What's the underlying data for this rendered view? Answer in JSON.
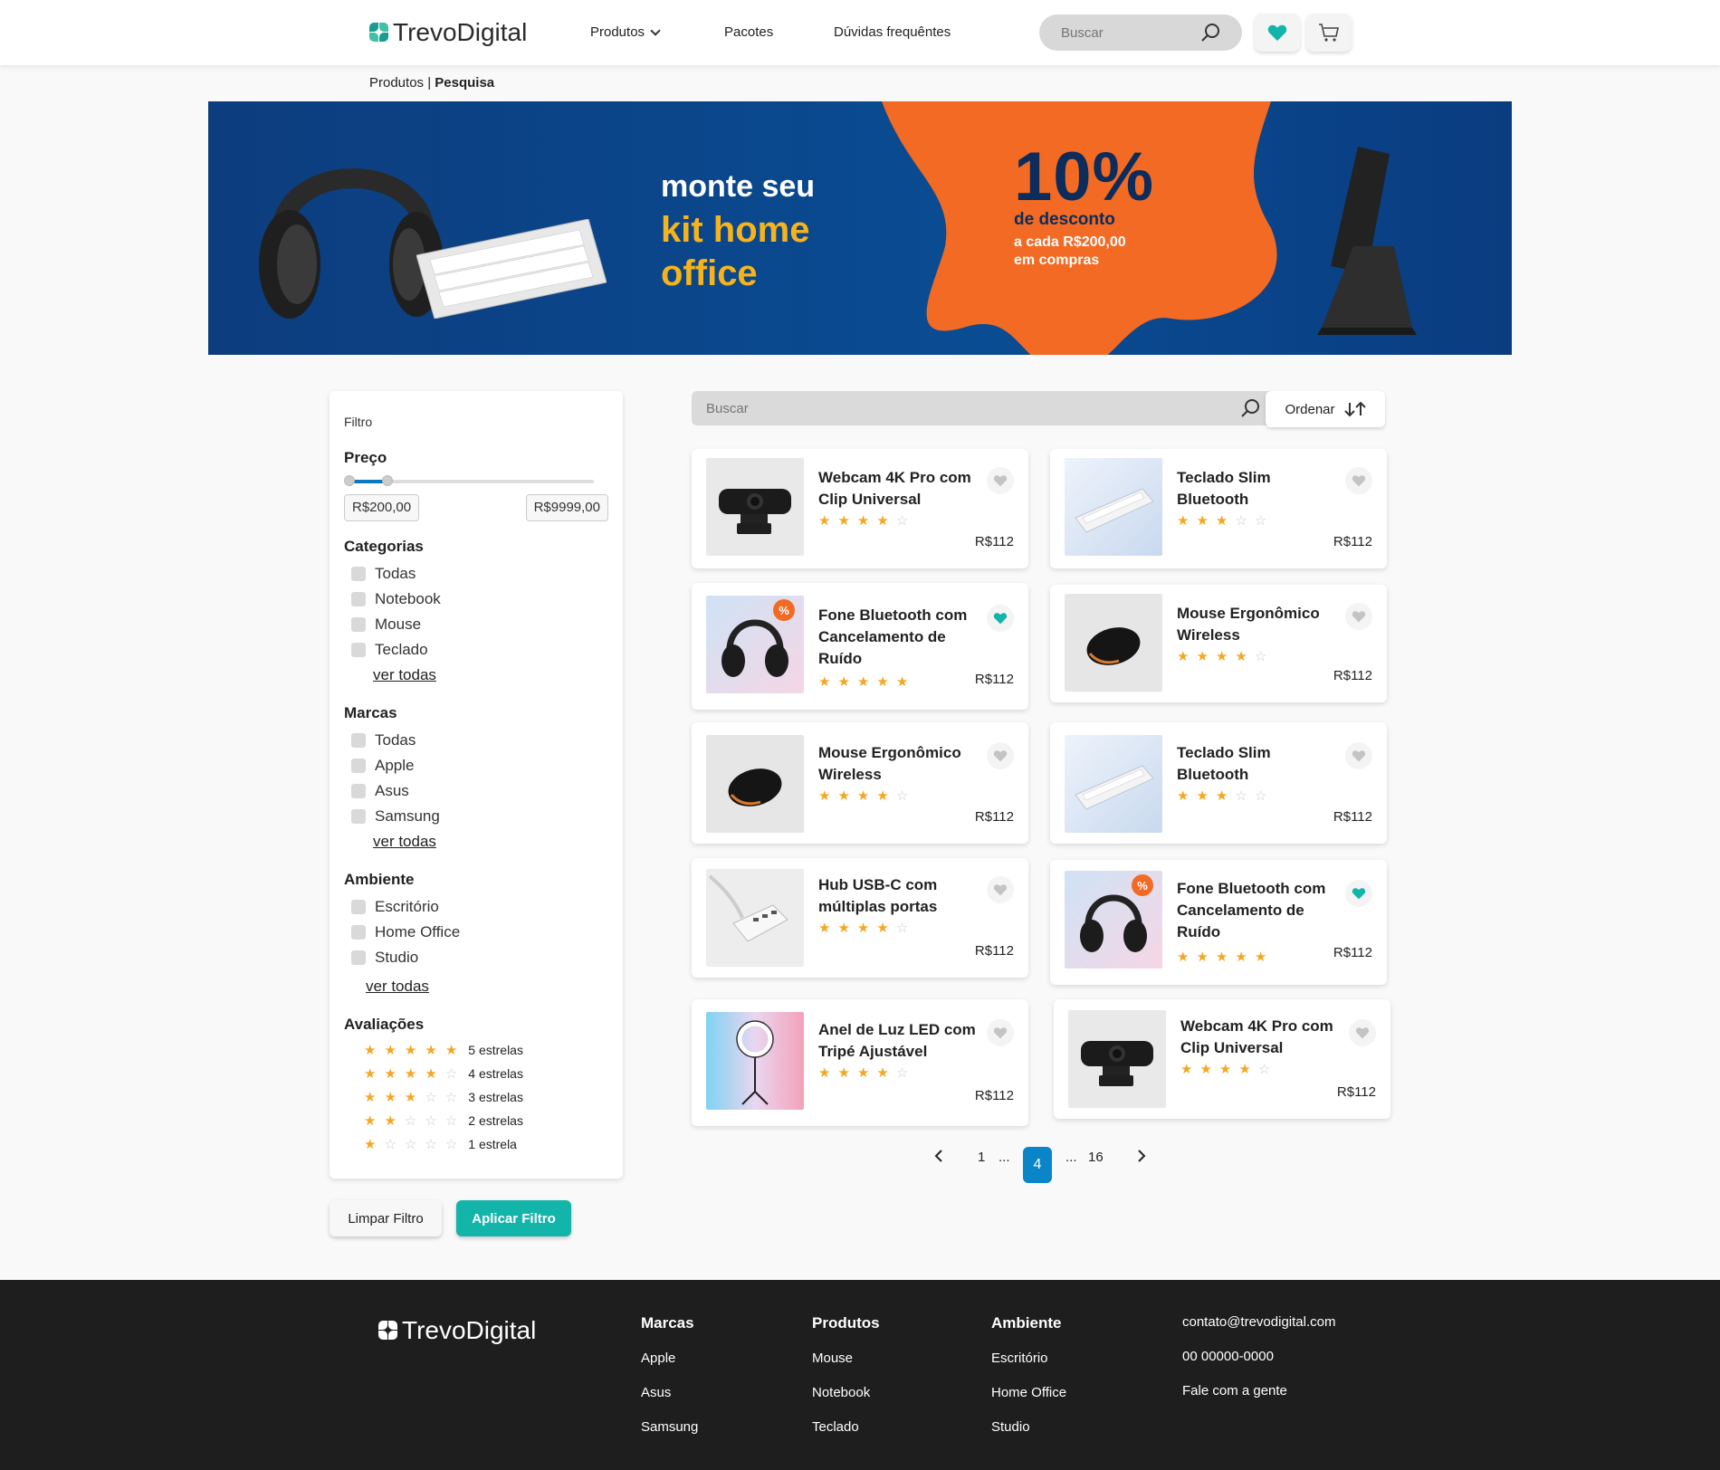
{
  "header": {
    "brand": "TrevoDigital",
    "nav": [
      "Produtos",
      "Pacotes",
      "Dúvidas frequêntes"
    ],
    "search_placeholder": "Buscar"
  },
  "breadcrumb": {
    "parent": "Produtos",
    "separator": " | ",
    "current": "Pesquisa"
  },
  "banner": {
    "line1": "monte seu",
    "line2": "kit home",
    "line3": "office",
    "percent": "10%",
    "discount": "de desconto",
    "condition_1": "a cada R$200,00",
    "condition_2": "em compras",
    "colors": {
      "background": "#0a4c93",
      "blob": "#f26a23",
      "highlight": "#f6b31b"
    }
  },
  "filter": {
    "title": "Filtro",
    "price": {
      "heading": "Preço",
      "min": "R$200,00",
      "max": "R$9999,00"
    },
    "categories": {
      "heading": "Categorias",
      "items": [
        "Todas",
        "Notebook",
        "Mouse",
        "Teclado"
      ],
      "more": "ver todas"
    },
    "brands": {
      "heading": "Marcas",
      "items": [
        "Todas",
        "Apple",
        "Asus",
        "Samsung"
      ],
      "more": "ver todas"
    },
    "environment": {
      "heading": "Ambiente",
      "items": [
        "Escritório",
        "Home Office",
        "Studio"
      ],
      "more": "ver todas"
    },
    "ratings": {
      "heading": "Avaliações",
      "items": [
        "5 estrelas",
        "4 estrelas",
        "3 estrelas",
        "2 estrelas",
        "1 estrela"
      ],
      "values": [
        5,
        4,
        3,
        2,
        1
      ]
    },
    "clear_label": "Limpar Filtro",
    "apply_label": "Aplicar Filtro"
  },
  "list": {
    "search_placeholder": "Buscar",
    "order_label": "Ordenar",
    "products": [
      {
        "name": "Webcam 4K Pro com Clip Universal",
        "rating": 4,
        "price": "R$112",
        "favorite": false,
        "image": "webcam"
      },
      {
        "name": "Teclado Slim Bluetooth",
        "rating": 3,
        "price": "R$112",
        "favorite": false,
        "image": "keyboard"
      },
      {
        "name": "Fone Bluetooth com Cancelamento de Ruído",
        "rating": 5,
        "price": "R$112",
        "favorite": true,
        "image": "headphones"
      },
      {
        "name": "Mouse Ergonômico Wireless",
        "rating": 4,
        "price": "R$112",
        "favorite": false,
        "image": "mouse"
      },
      {
        "name": "Mouse Ergonômico Wireless",
        "rating": 4,
        "price": "R$112",
        "favorite": false,
        "image": "mouse"
      },
      {
        "name": "Teclado Slim Bluetooth",
        "rating": 3,
        "price": "R$112",
        "favorite": false,
        "image": "keyboard"
      },
      {
        "name": "Hub USB-C com múltiplas portas",
        "rating": 4,
        "price": "R$112",
        "favorite": false,
        "image": "hub"
      },
      {
        "name": "Fone Bluetooth com Cancelamento de Ruído",
        "rating": 5,
        "price": "R$112",
        "favorite": true,
        "image": "headphones"
      },
      {
        "name": "Anel de Luz LED com Tripé Ajustável",
        "rating": 4,
        "price": "R$112",
        "favorite": false,
        "image": "ringlight"
      },
      {
        "name": "Webcam 4K Pro com Clip Universal",
        "rating": 4,
        "price": "R$112",
        "favorite": false,
        "image": "webcam"
      }
    ]
  },
  "pagination": {
    "first": "1",
    "ellipsis": "...",
    "current": "4",
    "last": "16"
  },
  "footer": {
    "brand": "TrevoDigital",
    "columns": [
      {
        "title": "Marcas",
        "links": [
          "Apple",
          "Asus",
          "Samsung"
        ]
      },
      {
        "title": "Produtos",
        "links": [
          "Mouse",
          "Notebook",
          "Teclado"
        ]
      },
      {
        "title": "Ambiente",
        "links": [
          "Escritório",
          "Home Office",
          "Studio"
        ]
      }
    ],
    "contact": [
      "contato@trevodigital.com",
      "00 00000-0000",
      "Fale com a gente"
    ]
  },
  "colors": {
    "accent": "#13b4aa",
    "star": "#f6a623",
    "primary_blue": "#0a86c8"
  }
}
